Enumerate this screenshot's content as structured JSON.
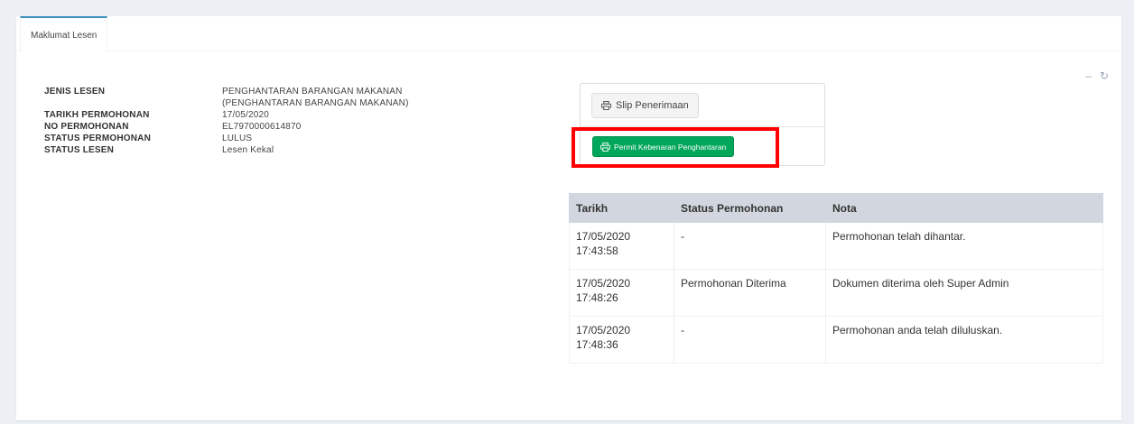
{
  "tabs": [
    {
      "label": "Maklumat Lesen"
    }
  ],
  "info": [
    {
      "label": "JENIS LESEN",
      "value": "PENGHANTARAN BARANGAN MAKANAN (PENGHANTARAN BARANGAN MAKANAN)"
    },
    {
      "label": "TARIKH PERMOHONAN",
      "value": "17/05/2020"
    },
    {
      "label": "NO PERMOHONAN",
      "value": "EL7970000614870"
    },
    {
      "label": "STATUS PERMOHONAN",
      "value": "LULUS"
    },
    {
      "label": "STATUS LESEN",
      "value": "Lesen Kekal"
    }
  ],
  "buttons": {
    "slip_label": "Slip Penerimaan",
    "permit_label": "Permit Kebenaran Penghantaran"
  },
  "history": {
    "headers": [
      "Tarikh",
      "Status Permohonan",
      "Nota"
    ],
    "rows": [
      {
        "date": "17/05/2020",
        "time": "17:43:58",
        "status": "-",
        "note": "Permohonan telah dihantar."
      },
      {
        "date": "17/05/2020",
        "time": "17:48:26",
        "status": "Permohonan Diterima",
        "note": "Dokumen diterima oleh Super Admin"
      },
      {
        "date": "17/05/2020",
        "time": "17:48:36",
        "status": "-",
        "note": "Permohonan anda telah diluluskan."
      }
    ]
  },
  "colors": {
    "accent": "#3c8dbc",
    "success": "#00a65a",
    "highlight": "#ff0000"
  }
}
